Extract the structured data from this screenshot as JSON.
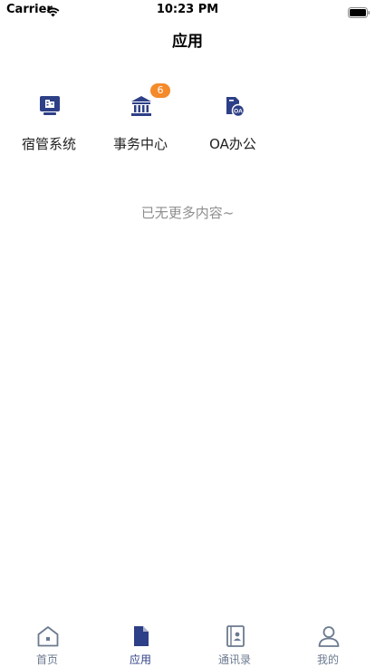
{
  "status_bar": {
    "carrier": "Carrier",
    "time": "10:23 PM"
  },
  "nav": {
    "title": "应用"
  },
  "apps": [
    {
      "label": "宿管系统",
      "icon": "dormitory-icon",
      "badge": ""
    },
    {
      "label": "事务中心",
      "icon": "bank-icon",
      "badge": "6"
    },
    {
      "label": "OA办公",
      "icon": "oa-document-icon",
      "badge": ""
    }
  ],
  "empty_hint": "已无更多内容~",
  "tabs": [
    {
      "label": "首页",
      "icon": "home-icon",
      "active": false
    },
    {
      "label": "应用",
      "icon": "document-icon",
      "active": true
    },
    {
      "label": "通讯录",
      "icon": "contacts-book-icon",
      "active": false
    },
    {
      "label": "我的",
      "icon": "user-icon",
      "active": false
    }
  ],
  "colors": {
    "accent": "#2d3f86",
    "badge": "#f58a2a",
    "tab_inactive": "#6b7a8f",
    "hint": "#8e8e8e"
  }
}
